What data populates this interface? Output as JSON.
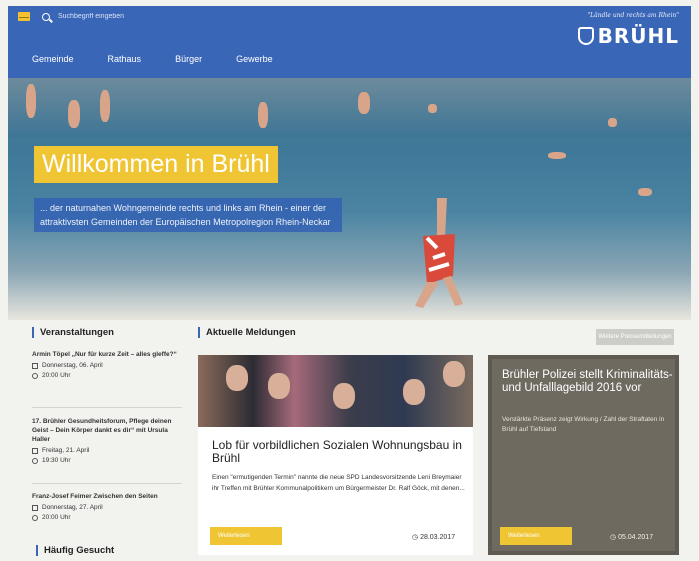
{
  "header": {
    "search_placeholder": "Suchbegriff eingeben",
    "nav": [
      "Gemeinde",
      "Rathaus",
      "Bürger",
      "Gewerbe"
    ],
    "slogan": "\"Ländle und rechts am Rhein\"",
    "brand": "BRÜHL"
  },
  "hero": {
    "title": "Willkommen in Brühl",
    "subtitle": "... der naturnahen Wohngemeinde rechts und links am Rhein - einer der attraktivsten Gemeinden der Europäischen Metropolregion Rhein-Neckar"
  },
  "events": {
    "heading": "Veranstaltungen",
    "items": [
      {
        "title": "Armin Töpel „Nur für kurze Zeit – alles gleffe?“",
        "date": "Donnerstag, 06. April",
        "time": "20:00 Uhr"
      },
      {
        "title": "17. Brühler Gesundheitsforum, Pflege deinen Geist – Dein Körper dankt es dir“ mit Ursula Haller",
        "date": "Freitag, 21. April",
        "time": "19:30 Uhr"
      },
      {
        "title": "Franz-Josef Feimer Zwischen den Seiten",
        "date": "Donnerstag, 27. April",
        "time": "20:00 Uhr"
      }
    ],
    "frequent_heading": "Häufig Gesucht"
  },
  "news": {
    "heading": "Aktuelle Meldungen",
    "archive_button": "Weitere Pressemitteilungen",
    "card": {
      "title": "Lob für vorbildlichen Sozialen Wohnungsbau in Brühl",
      "text": "Einen \"ermutigenden Termin\" nannte die neue SPD Landesvorsitzende Leni Breymaier ihr Treffen mit Brühler Kommunalpolitikern um Bürgermeister Dr. Ralf Göck, mit denen...",
      "button": "Weiterlesen",
      "date": "28.03.2017"
    },
    "police": {
      "title": "Brühler Polizei stellt Kriminalitäts- und Unfalllagebild 2016 vor",
      "text": "Verstärkte Präsenz zeigt Wirkung / Zahl der Straftaten in Brühl auf Tiefstand",
      "button": "Weiterlesen",
      "date": "05.04.2017"
    }
  },
  "colors": {
    "brand_blue": "#3a66b8",
    "accent_yellow": "#f0c534"
  }
}
